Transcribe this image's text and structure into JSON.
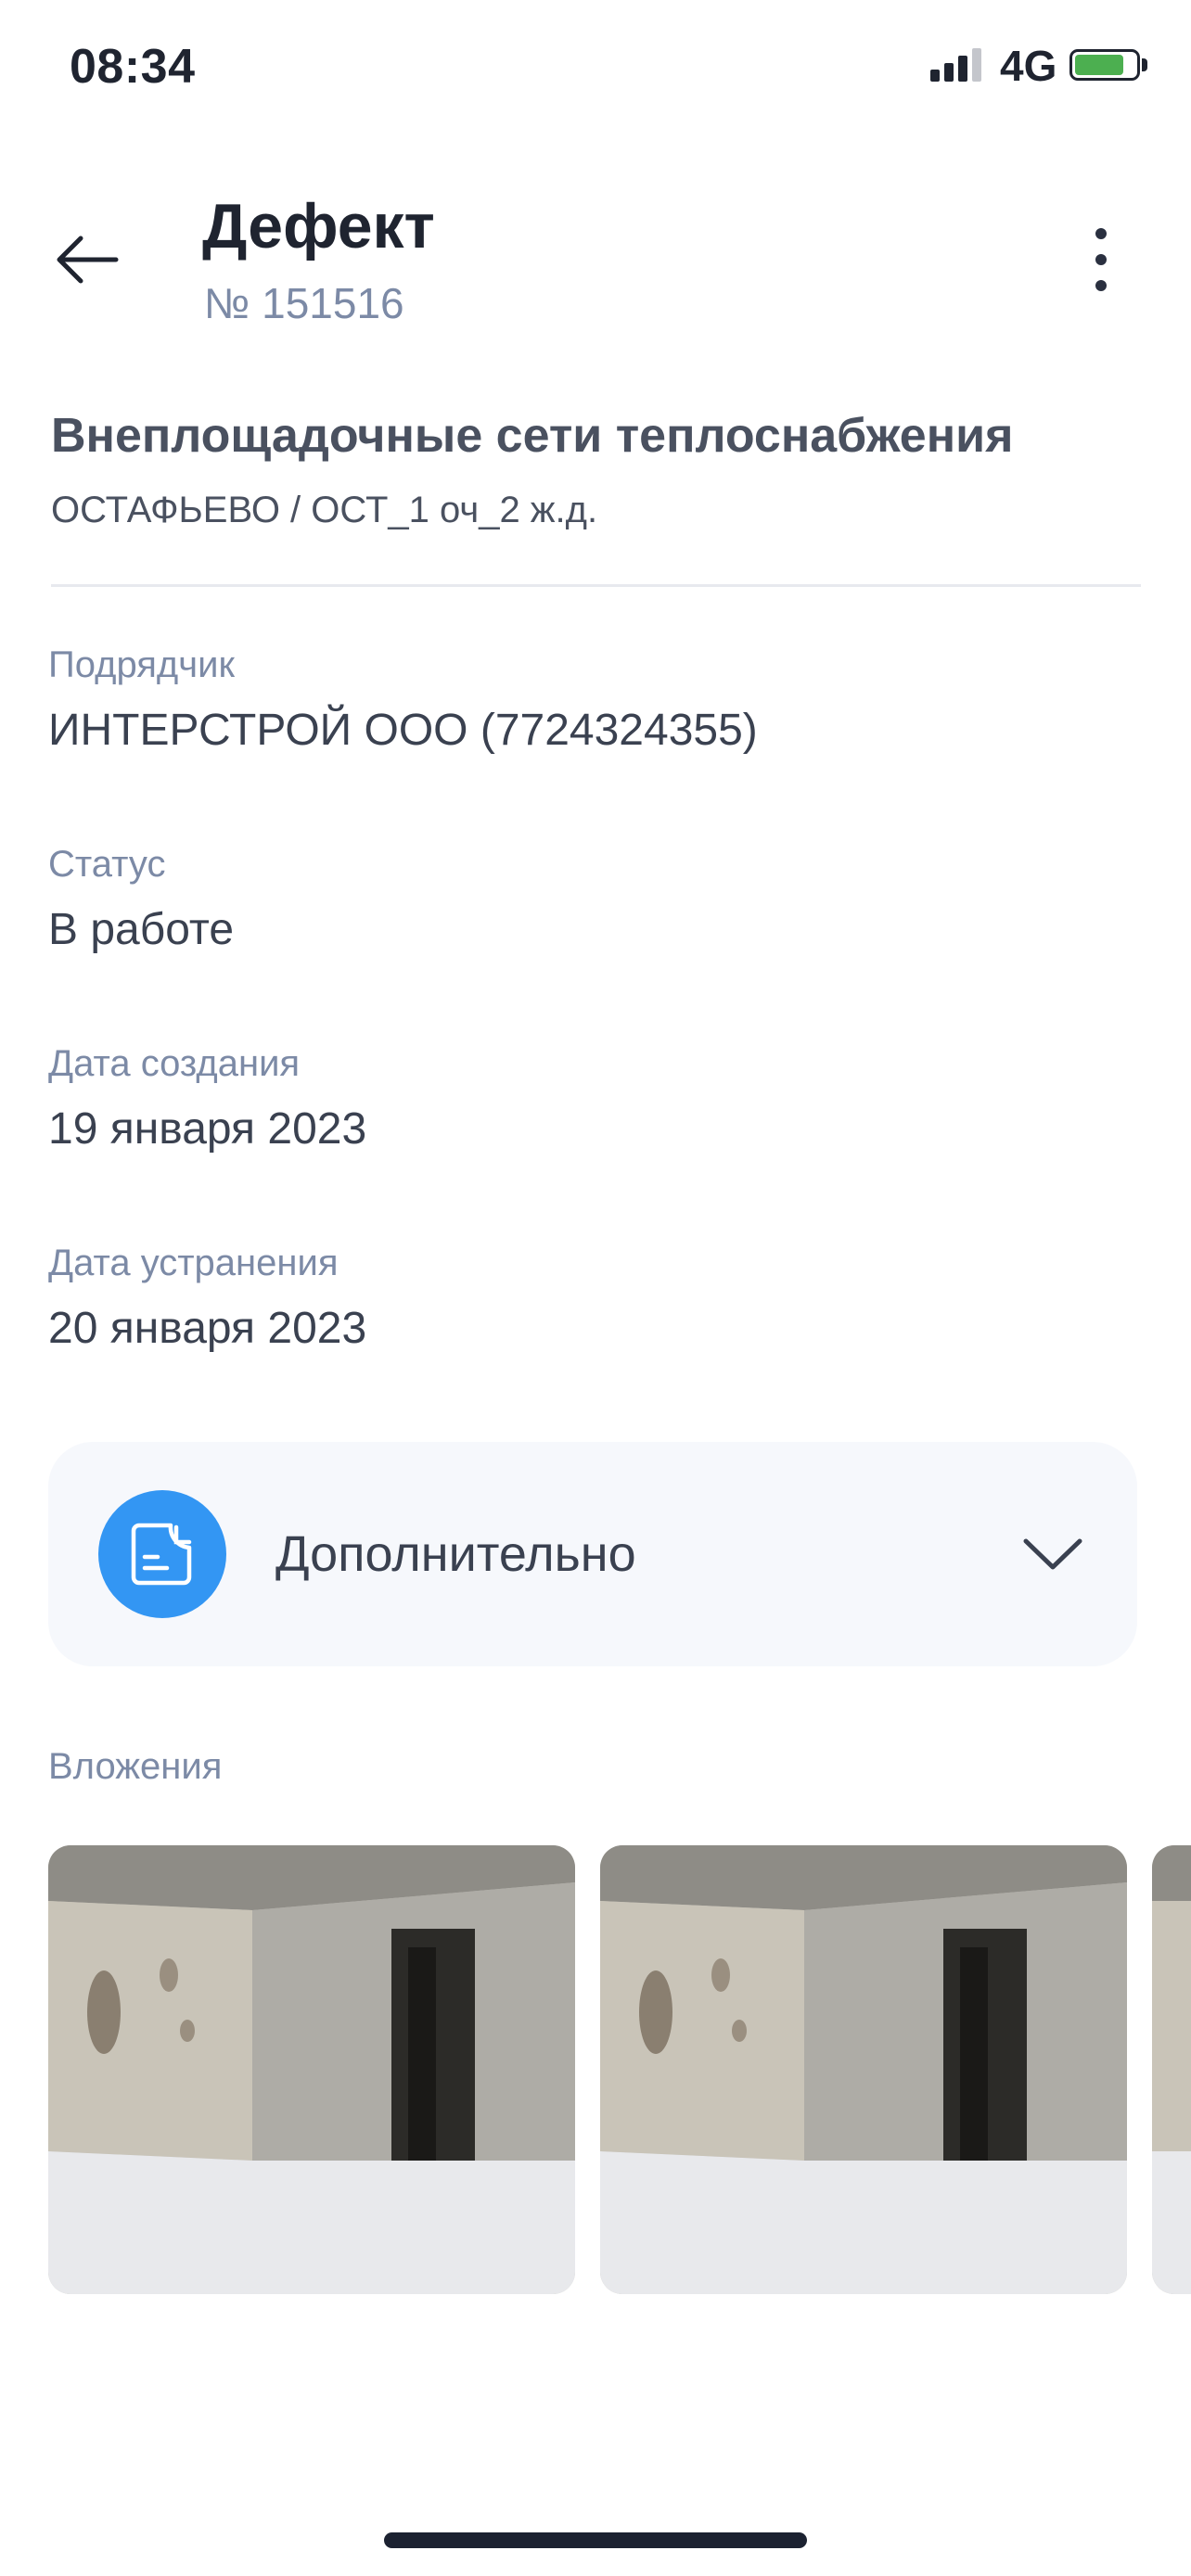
{
  "status_bar": {
    "time": "08:34",
    "network": "4G"
  },
  "header": {
    "title": "Дефект",
    "subtitle": "№ 151516"
  },
  "object": {
    "title": "Внеплощадочные сети теплоснабжения",
    "path": "ОСТАФЬЕВО / ОСТ_1 оч_2 ж.д."
  },
  "fields": [
    {
      "label": "Подрядчик",
      "value": "ИНТЕРСТРОЙ ООО (7724324355)"
    },
    {
      "label": "Статус",
      "value": "В работе"
    },
    {
      "label": "Дата создания",
      "value": "19 января 2023"
    },
    {
      "label": "Дата устранения",
      "value": "20 января 2023"
    }
  ],
  "extra": {
    "label": "Дополнительно",
    "icon": "document-clock-icon",
    "accent": "#3396f3"
  },
  "attachments": {
    "label": "Вложения",
    "count_visible": 3
  },
  "colors": {
    "title": "#1f2430",
    "label": "#7c8aa6",
    "value": "#3a4150",
    "panel_bg": "#f6f8fc",
    "battery": "#4caf50"
  }
}
